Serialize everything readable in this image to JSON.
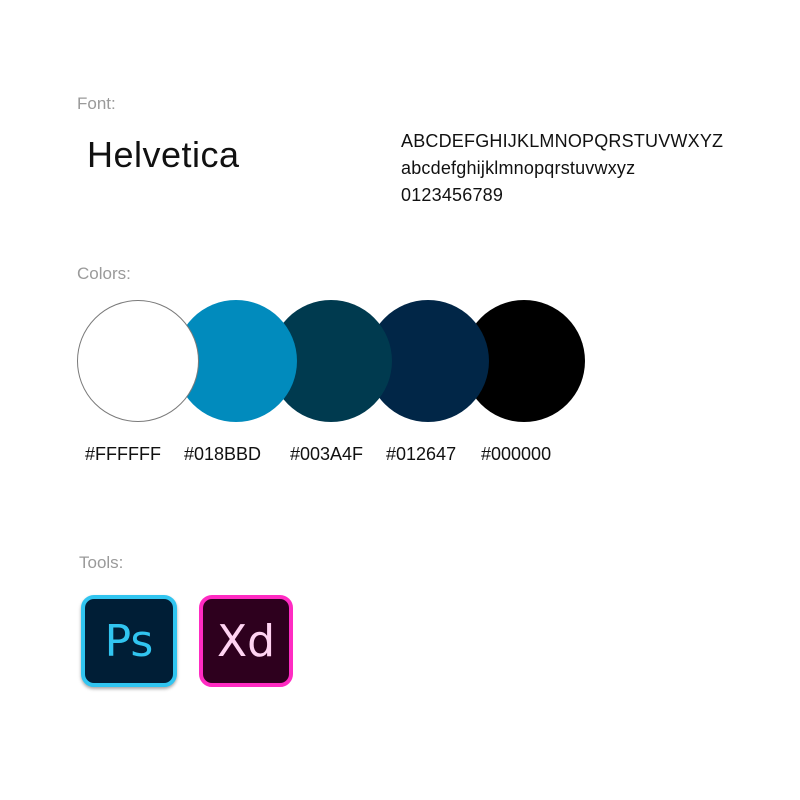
{
  "font": {
    "label": "Font:",
    "name": "Helvetica",
    "upper": "ABCDEFGHIJKLMNOPQRSTUVWXYZ",
    "lower": "abcdefghijklmnopqrstuvwxyz",
    "digits": "0123456789"
  },
  "colors": {
    "label": "Colors:",
    "swatches": [
      {
        "hex": "#FFFFFF",
        "label": "#FFFFFF"
      },
      {
        "hex": "#018BBD",
        "label": "#018BBD"
      },
      {
        "hex": "#003A4F",
        "label": "#003A4F"
      },
      {
        "hex": "#012647",
        "label": "#012647"
      },
      {
        "hex": "#000000",
        "label": "#000000"
      }
    ]
  },
  "tools": {
    "label": "Tools:",
    "items": [
      {
        "icon": "photoshop-icon",
        "text": "Ps",
        "bg": "#001E36",
        "accent": "#31C5F0"
      },
      {
        "icon": "xd-icon",
        "text": "Xd",
        "bg": "#2E001E",
        "accent": "#FF2BC2"
      }
    ]
  }
}
